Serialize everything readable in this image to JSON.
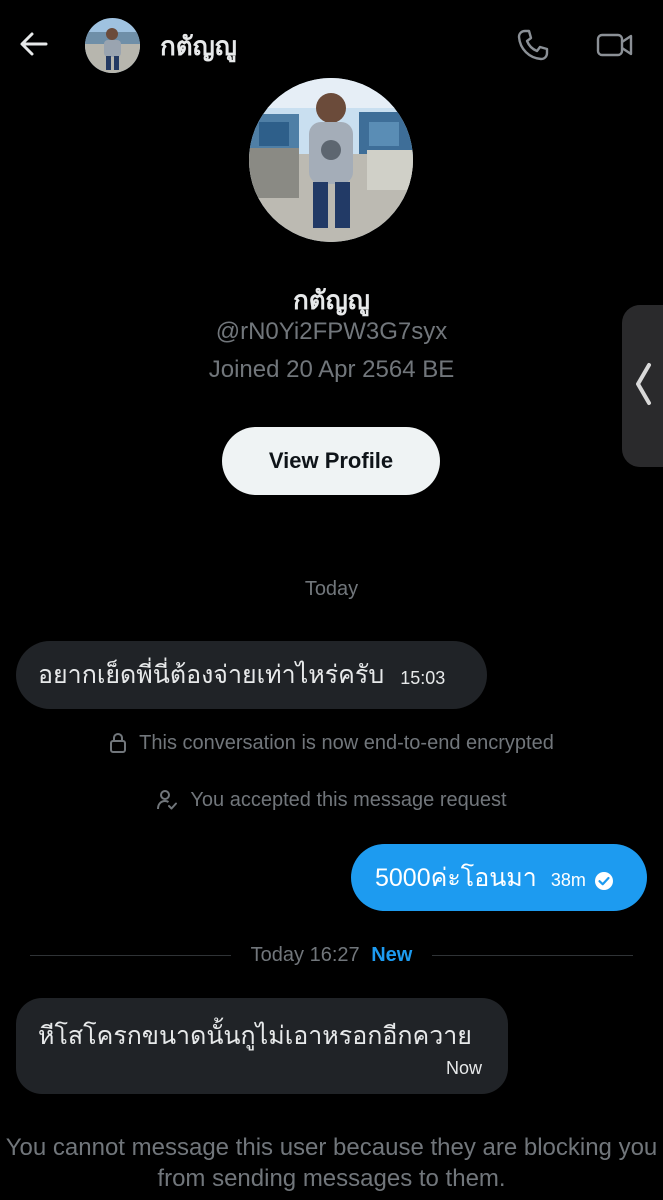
{
  "header": {
    "contact_name": "กตัญญู",
    "icons": {
      "back": "arrow-left-icon",
      "call": "phone-icon",
      "video": "video-camera-icon"
    }
  },
  "profile": {
    "name": "กตัญญู",
    "handle": "@rN0Yi2FPW3G7syx",
    "joined": "Joined 20 Apr 2564 BE",
    "view_profile_label": "View Profile"
  },
  "conversation": {
    "date_label": "Today",
    "messages": [
      {
        "direction": "incoming",
        "text": "อยากเย็ดพี่นี่ต้องจ่ายเท่าไหร่ครับ",
        "time": "15:03"
      },
      {
        "direction": "outgoing",
        "text": "5000ค่ะโอนมา",
        "time": "38m",
        "status_icon": "check-circle-icon"
      },
      {
        "direction": "incoming",
        "text": "หีโสโครกขนาดนั้นกูไม่เอาหรอกอีกควาย",
        "time": "Now"
      }
    ],
    "system": {
      "encrypted": "This conversation is now end-to-end encrypted",
      "accepted": "You accepted this message request"
    },
    "new_separator": {
      "time_label": "Today 16:27",
      "new_label": "New"
    },
    "blocked_note": "You cannot message this user because they are blocking you from sending messages to them."
  },
  "colors": {
    "background": "#000000",
    "accent": "#1d9bf0",
    "incoming_bubble": "#202327",
    "muted_text": "#71767b"
  }
}
